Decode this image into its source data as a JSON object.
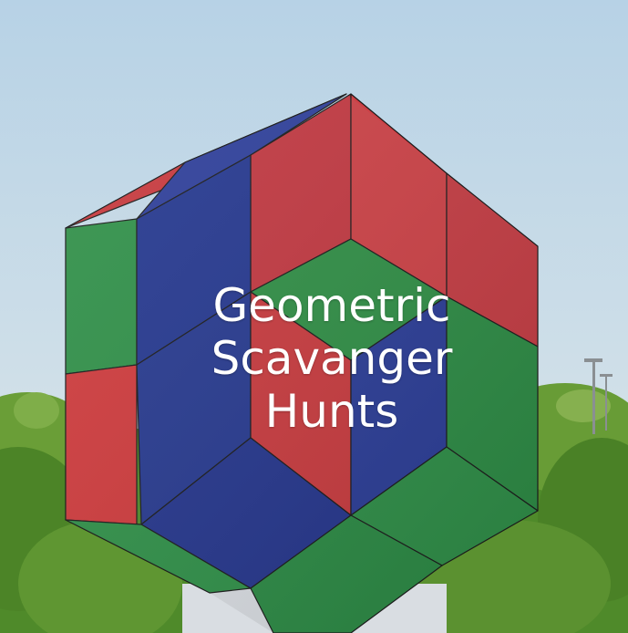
{
  "image": {
    "subject": "hexagonal cube sculpture of red, blue and green panels against a pale sky with green shrubs below",
    "colors": {
      "sky_top": "#b7d2e6",
      "sky_bottom": "#dbe6e6",
      "red": "#c43a3c",
      "blue": "#23368f",
      "green": "#2f8d45",
      "shrub": "#5b8f2e"
    }
  },
  "overlay": {
    "line1": "Geometric",
    "line2": "Scavanger",
    "line3": "Hunts"
  }
}
